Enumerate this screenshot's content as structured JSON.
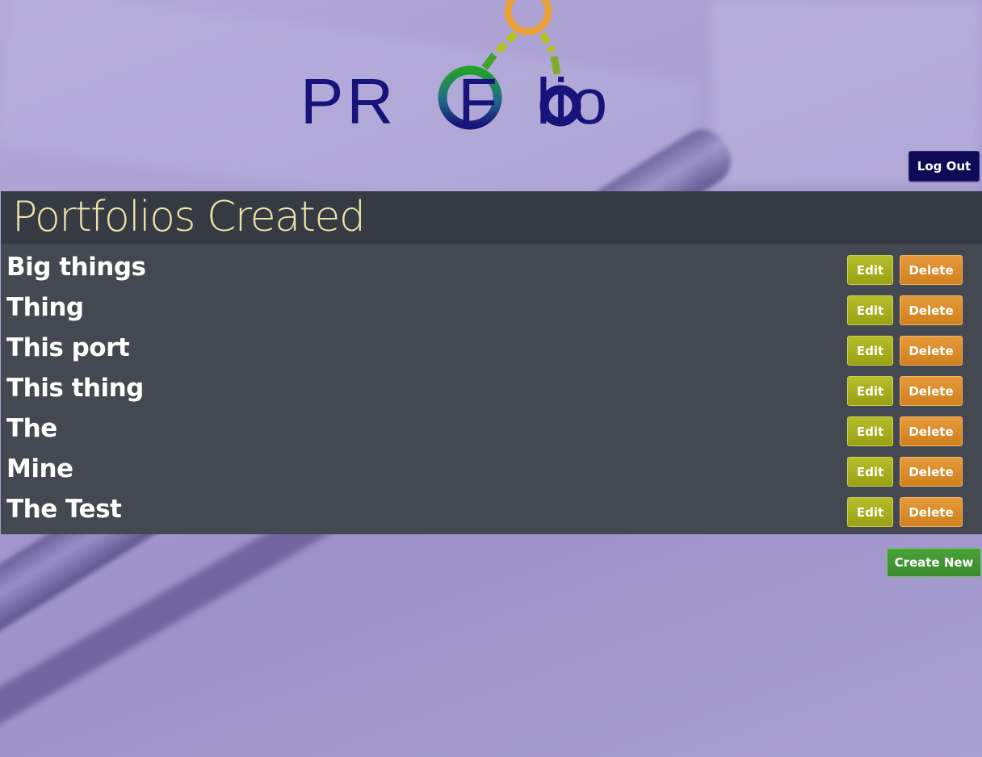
{
  "logo": {
    "text": "PROFolio"
  },
  "header": {
    "logout_label": "Log Out"
  },
  "panel": {
    "title": "Portfolios Created",
    "portfolios": [
      {
        "name": "Big things",
        "edit_label": "Edit",
        "delete_label": "Delete"
      },
      {
        "name": "Thing",
        "edit_label": "Edit",
        "delete_label": "Delete"
      },
      {
        "name": "This port",
        "edit_label": "Edit",
        "delete_label": "Delete"
      },
      {
        "name": "This thing",
        "edit_label": "Edit",
        "delete_label": "Delete"
      },
      {
        "name": "The",
        "edit_label": "Edit",
        "delete_label": "Delete"
      },
      {
        "name": "Mine",
        "edit_label": "Edit",
        "delete_label": "Delete"
      },
      {
        "name": "The Test",
        "edit_label": "Edit",
        "delete_label": "Delete"
      }
    ]
  },
  "footer": {
    "create_label": "Create New"
  },
  "colors": {
    "logout": "#0d0b55",
    "edit": "#a3aa1b",
    "delete": "#db8a2a",
    "create": "#42963a",
    "title": "#ece3a8",
    "logo_text": "#16137a"
  }
}
